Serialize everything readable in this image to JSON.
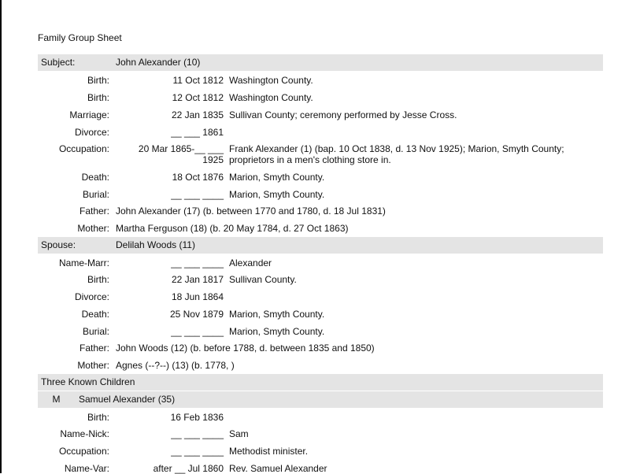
{
  "title": "Family Group Sheet",
  "subject": {
    "label": "Subject:",
    "name": "John Alexander (10)",
    "events": [
      {
        "label": "Birth:",
        "date": "11 Oct 1812",
        "place": "Washington County."
      },
      {
        "label": "Birth:",
        "date": "12 Oct 1812",
        "place": "Washington County."
      },
      {
        "label": "Marriage:",
        "date": "22 Jan 1835",
        "place": "Sullivan County; ceremony performed by Jesse Cross."
      },
      {
        "label": "Divorce:",
        "date": "__ ___ 1861",
        "place": ""
      },
      {
        "label": "Occupation:",
        "date": "20 Mar 1865-__ ___\n1925",
        "place": "Frank Alexander (1) (bap. 10 Oct 1838, d. 13 Nov 1925); Marion, Smyth County;\nproprietors in a men's clothing store in."
      },
      {
        "label": "Death:",
        "date": "18 Oct 1876",
        "place": "Marion, Smyth County."
      },
      {
        "label": "Burial:",
        "date": "__ ___ ____",
        "place": "Marion, Smyth County."
      }
    ],
    "father_label": "Father:",
    "father": "John Alexander (17) (b. between 1770 and 1780, d. 18 Jul 1831)",
    "mother_label": "Mother:",
    "mother": "Martha Ferguson (18) (b. 20 May 1784, d. 27 Oct 1863)"
  },
  "spouse": {
    "label": "Spouse:",
    "name": "Delilah Woods (11)",
    "events": [
      {
        "label": "Name-Marr:",
        "date": "__ ___ ____",
        "place": "Alexander"
      },
      {
        "label": "Birth:",
        "date": "22 Jan 1817",
        "place": "Sullivan County."
      },
      {
        "label": "Divorce:",
        "date": "18 Jun 1864",
        "place": ""
      },
      {
        "label": "Death:",
        "date": "25 Nov 1879",
        "place": "Marion, Smyth County."
      },
      {
        "label": "Burial:",
        "date": "__ ___ ____",
        "place": "Marion, Smyth County."
      }
    ],
    "father_label": "Father:",
    "father": "John Woods (12) (b. before 1788, d. between 1835 and 1850)",
    "mother_label": "Mother:",
    "mother": "Agnes (--?--) (13) (b. 1778,          )"
  },
  "children": {
    "heading": "Three Known Children",
    "list": [
      {
        "sex": "M",
        "name": "Samuel Alexander (35)",
        "events": [
          {
            "label": "Birth:",
            "date": "16 Feb 1836",
            "place": ""
          },
          {
            "label": "Name-Nick:",
            "date": "__ ___ ____",
            "place": "Sam"
          },
          {
            "label": "Occupation:",
            "date": "__ ___ ____",
            "place": "Methodist minister."
          },
          {
            "label": "Name-Var:",
            "date": "after __ Jul 1860",
            "place": "Rev. Samuel Alexander"
          }
        ]
      }
    ]
  }
}
